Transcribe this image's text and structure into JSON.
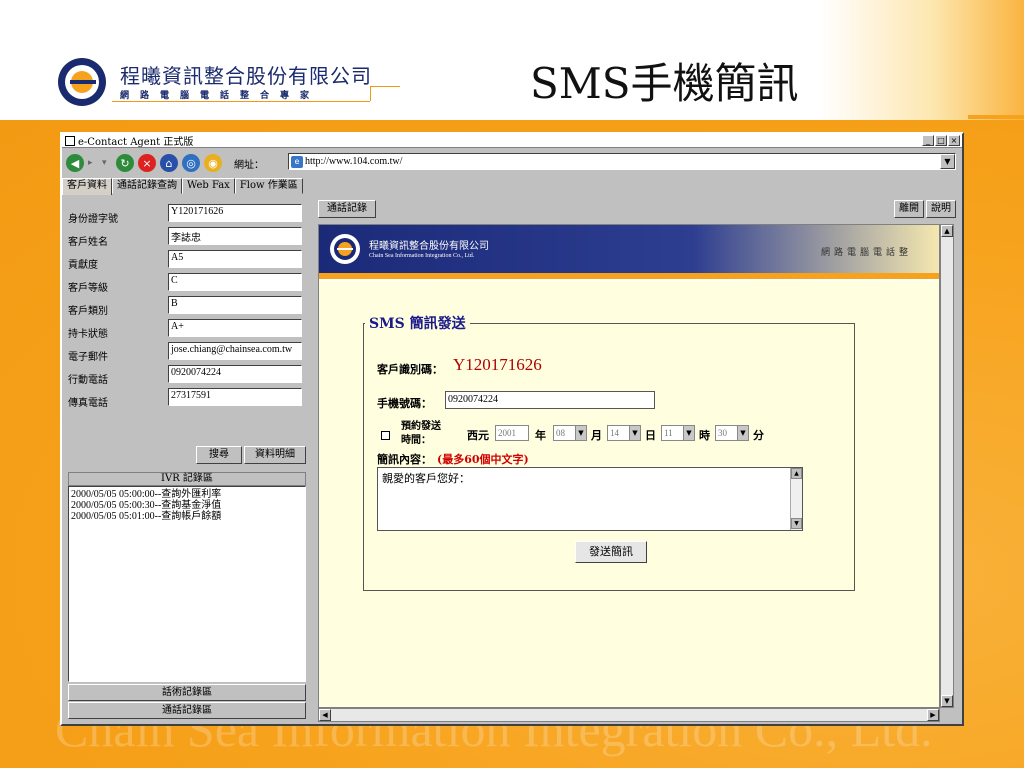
{
  "slide": {
    "company_cn": "程曦資訊整合股份有限公司",
    "company_sub": "網路電腦電話整合專家",
    "title": "SMS手機簡訊",
    "watermark": "Chain Sea Information Integration Co., Ltd."
  },
  "window": {
    "title": "e-Contact Agent 正式版",
    "btn_min": "_",
    "btn_max": "□",
    "btn_close": "×"
  },
  "toolbar": {
    "address_label": "網址：",
    "address_value": "http://www.104.com.tw/",
    "dropdown_glyph": "▼"
  },
  "tabs": [
    "客戶資料",
    "通話記錄查詢",
    "Web Fax",
    "Flow 作業區"
  ],
  "customer": {
    "fields": [
      {
        "label": "身份證字號",
        "value": "Y120171626"
      },
      {
        "label": "客戶姓名",
        "value": "李誌忠"
      },
      {
        "label": "貢獻度",
        "value": "A5"
      },
      {
        "label": "客戶等級",
        "value": "C"
      },
      {
        "label": "客戶類別",
        "value": "B"
      },
      {
        "label": "持卡狀態",
        "value": "A+"
      },
      {
        "label": "電子郵件",
        "value": "jose.chiang@chainsea.com.tw"
      },
      {
        "label": "行動電話",
        "value": "0920074224"
      },
      {
        "label": "傳真電話",
        "value": "27317591"
      }
    ],
    "search_btn": "搜尋",
    "detail_btn": "資料明細"
  },
  "ivr": {
    "header": "IVR 記錄區",
    "items": [
      "2000/05/05 05:00:00--查詢外匯利率",
      "2000/05/05 05:00:30--查詢基金淨值",
      "2000/05/05 05:01:00--查詢帳戶餘額"
    ],
    "script_area": "話術記錄區",
    "call_area": "通話記錄區"
  },
  "right": {
    "call_log_btn": "通話記錄",
    "leave_btn": "離開",
    "help_btn": "說明"
  },
  "banner": {
    "cn": "程曦資訊整合股份有限公司",
    "en": "Chain Sea Information Integration Co., Ltd.",
    "right": "網路電腦電話整"
  },
  "sms": {
    "legend": "SMS 簡訊發送",
    "client_id_label": "客戶識別碼：",
    "client_id": "Y120171626",
    "phone_label": "手機號碼：",
    "phone_value": "0920074224",
    "schedule_label_1": "預約發送",
    "schedule_label_2": "時間：",
    "era_label": "西元",
    "year": "2001",
    "year_unit": "年",
    "month": "08",
    "month_unit": "月",
    "day": "14",
    "day_unit": "日",
    "hour": "11",
    "hour_unit": "時",
    "minute": "30",
    "minute_unit": "分",
    "content_label": "簡訊內容：",
    "max_note": "(最多60個中文字)",
    "message": "親愛的客戶您好：",
    "send_btn": "發送簡訊"
  },
  "colors": {
    "slide_orange": "#f7a21c",
    "banner_blue": "#1b2a78",
    "content_bg": "#ffffe0",
    "client_id_red": "#b00000"
  }
}
